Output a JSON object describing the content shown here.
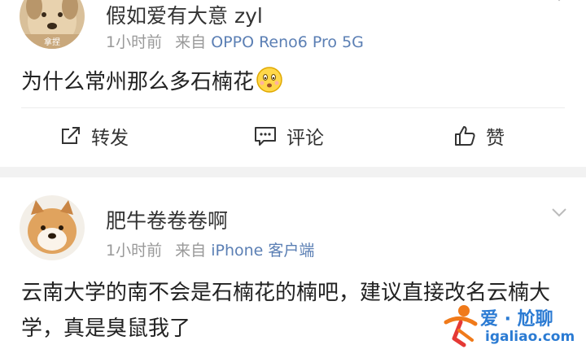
{
  "posts": [
    {
      "username": "假如爱有大意 zyl",
      "time": "1小时前",
      "source_prefix": "来自",
      "source": "OPPO Reno6 Pro 5G",
      "text": "为什么常州那么多石楠花",
      "emoji": "thinking-face",
      "avatar_badge": "拿捏"
    },
    {
      "username": "肥牛卷卷卷啊",
      "time": "1小时前",
      "source_prefix": "来自",
      "source": "iPhone 客户端",
      "text": "云南大学的南不会是石楠花的楠吧，建议直接改名云楠大学，真是臭鼠我了"
    }
  ],
  "actions": {
    "repost": "转发",
    "comment": "评论",
    "like": "赞"
  },
  "watermark": {
    "title": "爱 · 尬聊",
    "url": "igaliao.com"
  },
  "colors": {
    "source_link": "#5b7fb4",
    "meta_gray": "#999999",
    "separator": "#f2f2f2",
    "watermark": "#2b7bd3"
  }
}
